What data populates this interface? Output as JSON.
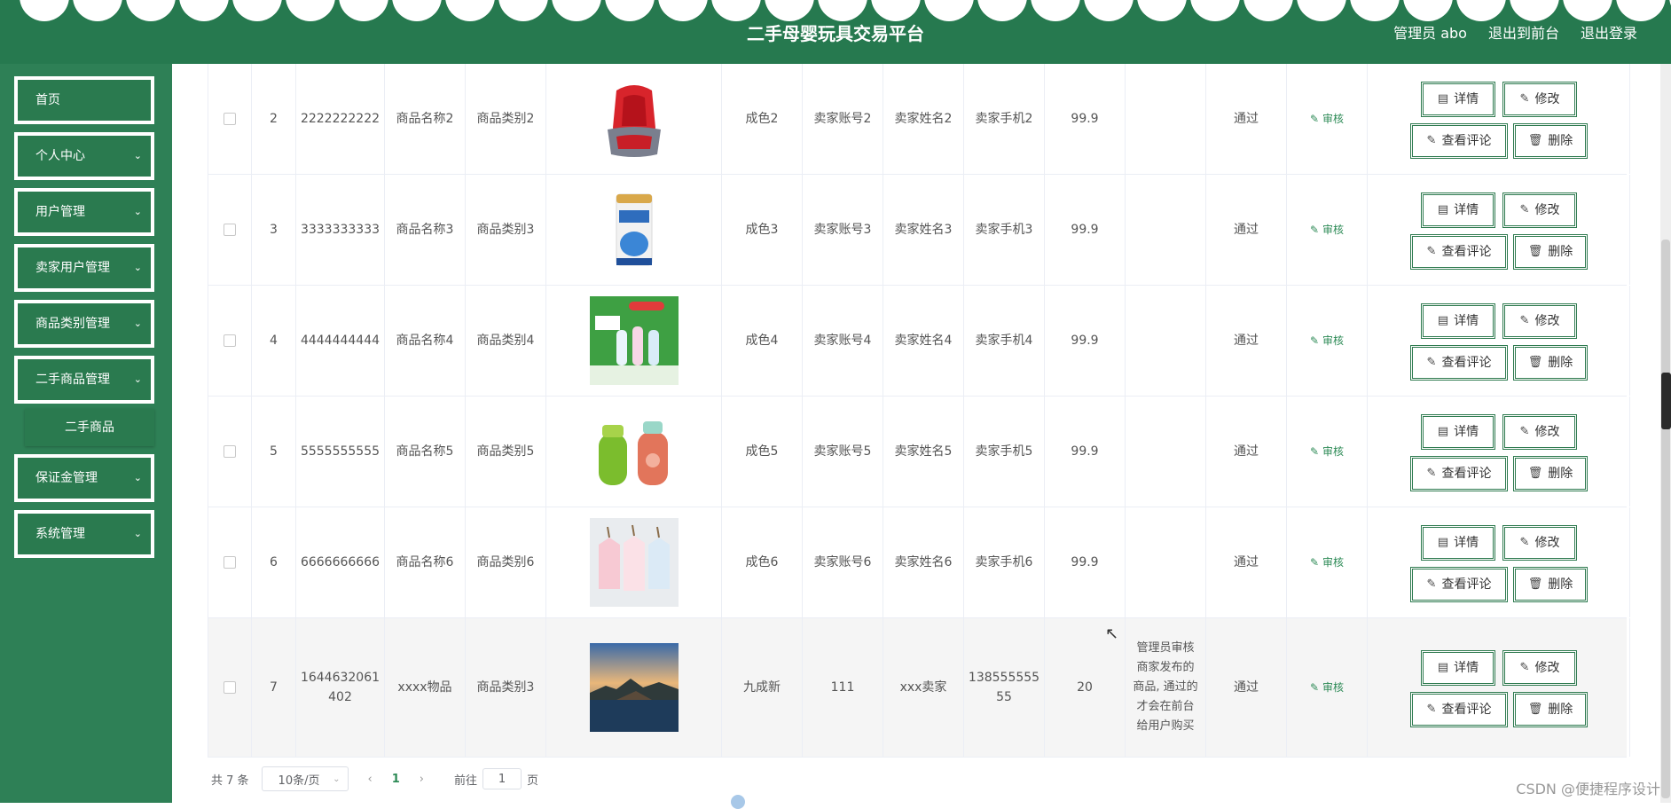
{
  "header": {
    "title": "二手母婴玩具交易平台",
    "admin_label": "管理员 abo",
    "to_front_label": "退出到前台",
    "logout_label": "退出登录"
  },
  "sidebar": {
    "items": [
      {
        "label": "首页"
      },
      {
        "label": "个人中心"
      },
      {
        "label": "用户管理"
      },
      {
        "label": "卖家用户管理"
      },
      {
        "label": "商品类别管理"
      },
      {
        "label": "二手商品管理"
      },
      {
        "label": "保证金管理"
      },
      {
        "label": "系统管理"
      }
    ],
    "submenu": {
      "label": "二手商品"
    }
  },
  "actions": {
    "detail": "详情",
    "edit": "修改",
    "comments": "查看评论",
    "delete": "删除",
    "audit": "审核"
  },
  "rows": [
    {
      "index": "2",
      "code": "2222222222",
      "name": "商品名称2",
      "category": "商品类别2",
      "image": "car-seat",
      "condition": "成色2",
      "seller_account": "卖家账号2",
      "seller_name": "卖家姓名2",
      "seller_phone": "卖家手机2",
      "price": "99.9",
      "note": "",
      "status": "通过"
    },
    {
      "index": "3",
      "code": "3333333333",
      "name": "商品名称3",
      "category": "商品类别3",
      "image": "milk-powder-can",
      "condition": "成色3",
      "seller_account": "卖家账号3",
      "seller_name": "卖家姓名3",
      "seller_phone": "卖家手机3",
      "price": "99.9",
      "note": "",
      "status": "通过"
    },
    {
      "index": "4",
      "code": "4444444444",
      "name": "商品名称4",
      "category": "商品类别4",
      "image": "baby-bottles-set",
      "condition": "成色4",
      "seller_account": "卖家账号4",
      "seller_name": "卖家姓名4",
      "seller_phone": "卖家手机4",
      "price": "99.9",
      "note": "",
      "status": "通过"
    },
    {
      "index": "5",
      "code": "5555555555",
      "name": "商品名称5",
      "category": "商品类别5",
      "image": "sippy-cups",
      "condition": "成色5",
      "seller_account": "卖家账号5",
      "seller_name": "卖家姓名5",
      "seller_phone": "卖家手机5",
      "price": "99.9",
      "note": "",
      "status": "通过"
    },
    {
      "index": "6",
      "code": "6666666666",
      "name": "商品名称6",
      "category": "商品类别6",
      "image": "baby-clothes",
      "condition": "成色6",
      "seller_account": "卖家账号6",
      "seller_name": "卖家姓名6",
      "seller_phone": "卖家手机6",
      "price": "99.9",
      "note": "",
      "status": "通过"
    },
    {
      "index": "7",
      "code": "1644632061402",
      "name": "xxxx物品",
      "category": "商品类别3",
      "image": "landscape-photo",
      "condition": "九成新",
      "seller_account": "111",
      "seller_name": "xxx卖家",
      "seller_phone": "13855555555",
      "price": "20",
      "note": "管理员审核商家发布的商品, 通过的才会在前台给用户购买",
      "status": "通过"
    }
  ],
  "pagination": {
    "total": "共 7 条",
    "page_size": "10条/页",
    "prev": "‹",
    "current": "1",
    "next": "›",
    "goto_prefix": "前往",
    "goto_value": "1",
    "goto_suffix": "页"
  },
  "watermark": "CSDN @便捷程序设计",
  "colors": {
    "header": "#26794f",
    "sidebar": "#2e8056",
    "accent": "#2e8b57"
  }
}
